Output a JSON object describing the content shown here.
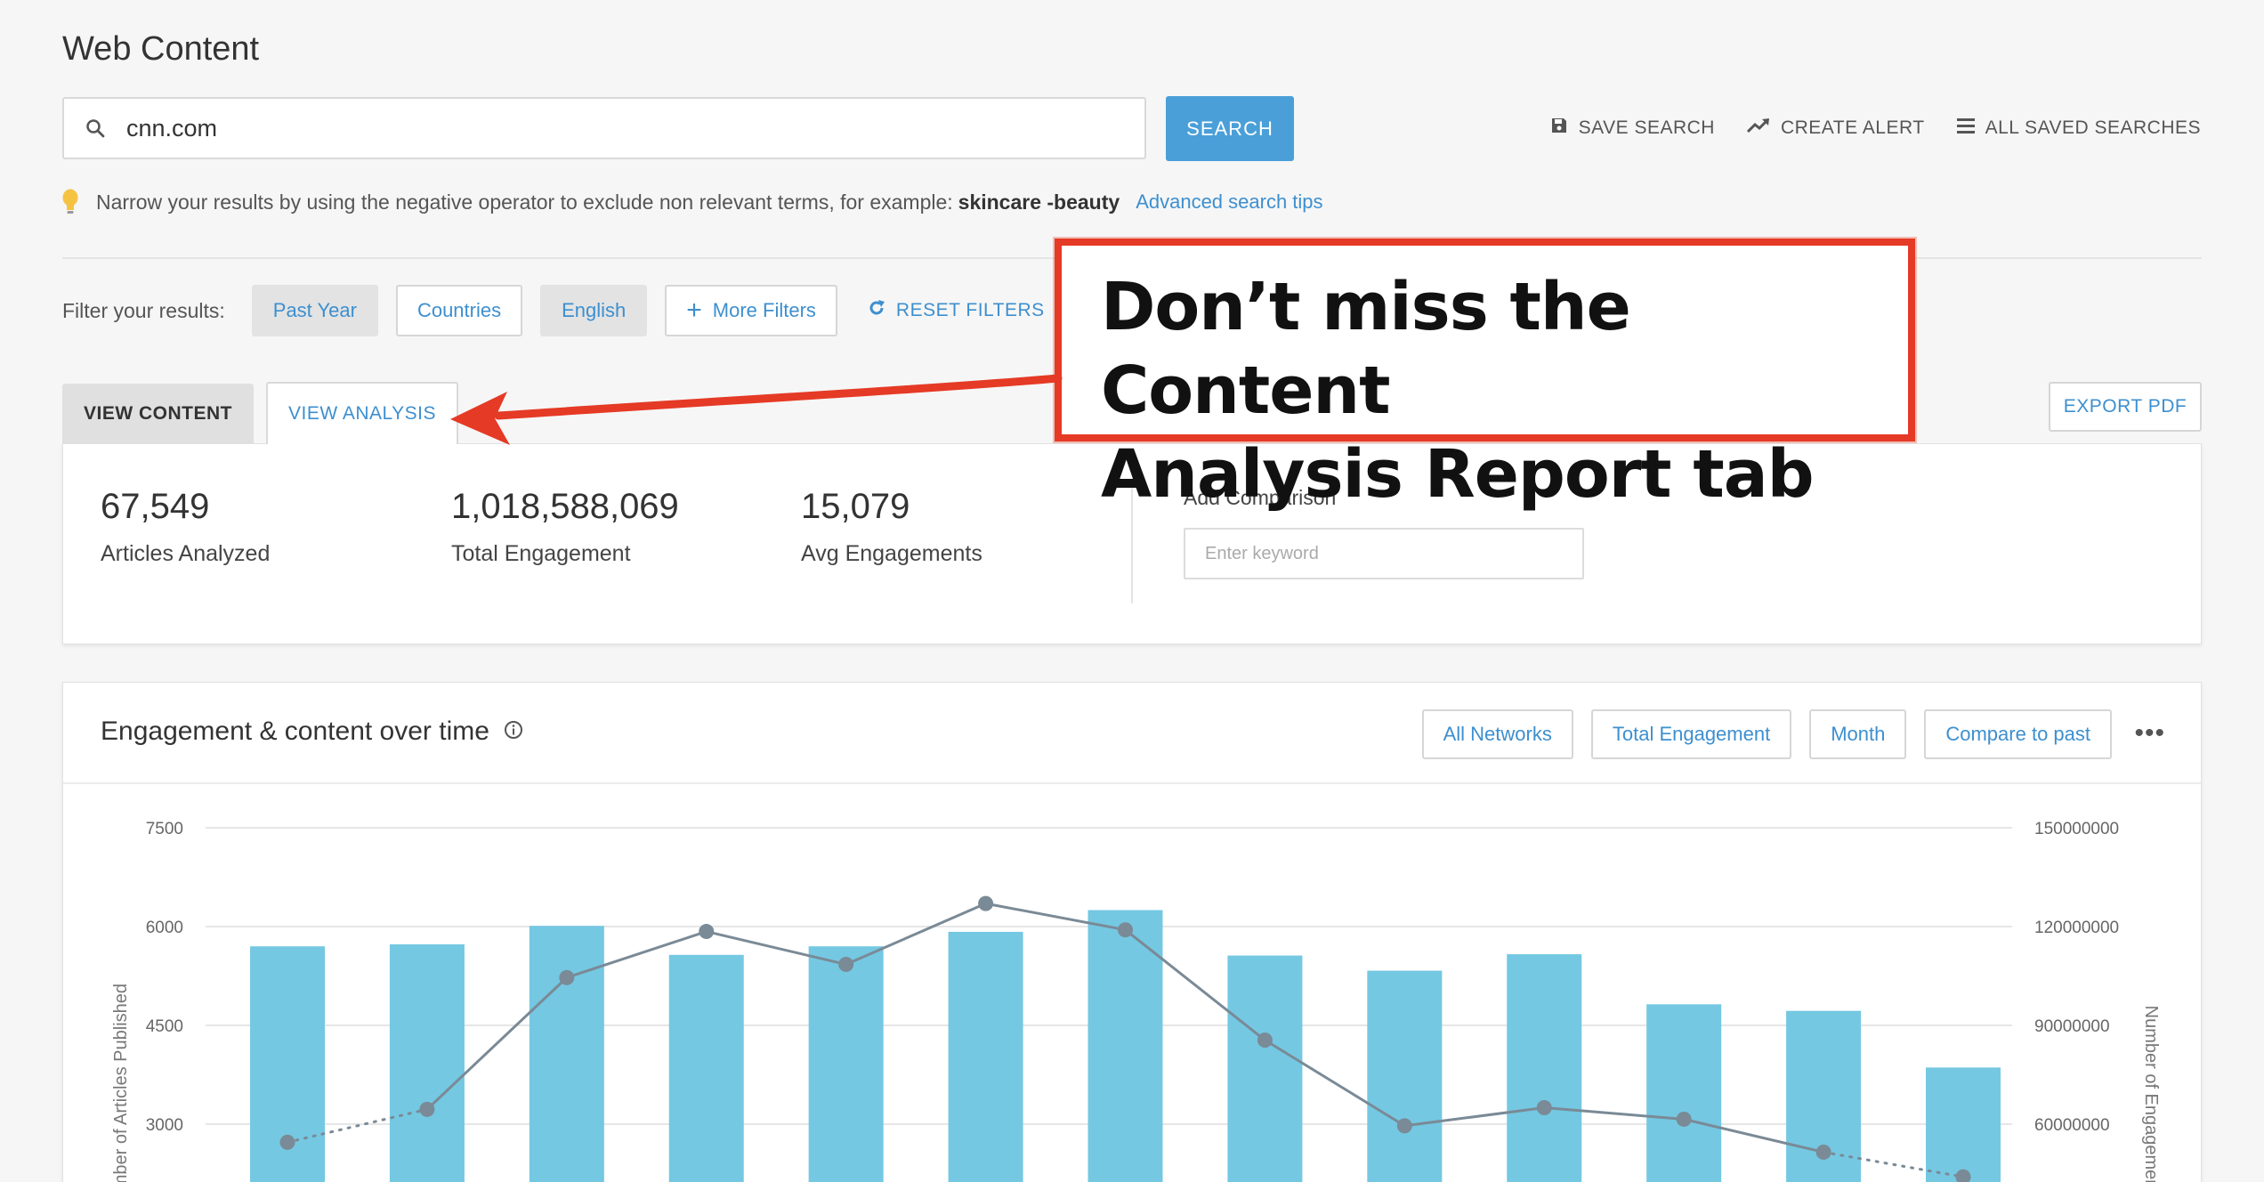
{
  "page": {
    "title": "Web Content"
  },
  "search": {
    "value": "cnn.com",
    "button_label": "SEARCH"
  },
  "top_actions": [
    {
      "label": "SAVE SEARCH",
      "icon": "save-icon"
    },
    {
      "label": "CREATE ALERT",
      "icon": "trending-up-icon"
    },
    {
      "label": "ALL SAVED SEARCHES",
      "icon": "list-icon"
    }
  ],
  "tip": {
    "text": "Narrow your results by using the negative operator to exclude non relevant terms, for example:",
    "example": "skincare -beauty",
    "link": "Advanced search tips"
  },
  "filters": {
    "label": "Filter your results:",
    "chips": [
      "Past Year",
      "Countries",
      "English"
    ],
    "more": "More Filters",
    "reset": "RESET FILTERS"
  },
  "tabs": {
    "content": "VIEW CONTENT",
    "analysis": "VIEW ANALYSIS"
  },
  "export_label": "EXPORT PDF",
  "stats": [
    {
      "value": "67,549",
      "label": "Articles Analyzed"
    },
    {
      "value": "1,018,588,069",
      "label": "Total Engagement"
    },
    {
      "value": "15,079",
      "label": "Avg Engagements"
    }
  ],
  "comparison": {
    "label": "Add Comparison",
    "placeholder": "Enter keyword"
  },
  "chart_panel": {
    "title": "Engagement & content over time",
    "controls": [
      "All Networks",
      "Total Engagement",
      "Month",
      "Compare to past"
    ],
    "more": "•••"
  },
  "callout": {
    "line1": "Don’t miss the Content",
    "line2": "Analysis Report tab"
  },
  "colors": {
    "accent": "#3d8fcf",
    "search_button": "#4a9fd8",
    "bar": "#74c8e2",
    "line": "#7a8a96",
    "callout": "#e53a25",
    "bulb": "#f5c342"
  },
  "chart_data": {
    "type": "bar",
    "left_axis": {
      "label": "Number of Articles Published",
      "ticks": [
        "7500",
        "6000",
        "4500",
        "3000"
      ],
      "visible_range": [
        2150,
        7500
      ]
    },
    "right_axis": {
      "label": "Number of Engagements",
      "ticks": [
        "150000000",
        "120000000",
        "90000000",
        "60000000"
      ],
      "visible_range": [
        43000000,
        150000000
      ]
    },
    "grid": true,
    "series": [
      {
        "name": "Number of Articles Published",
        "type": "bar",
        "values": [
          5700,
          5730,
          6010,
          5570,
          5700,
          5920,
          6250,
          5560,
          5330,
          5580,
          4820,
          4720,
          3860
        ]
      },
      {
        "name": "Number of Engagements",
        "type": "line",
        "values": [
          54500000,
          64500000,
          104500000,
          118500000,
          108500000,
          127000000,
          119000000,
          85500000,
          59500000,
          65000000,
          61500000,
          51500000,
          44000000
        ]
      }
    ]
  }
}
